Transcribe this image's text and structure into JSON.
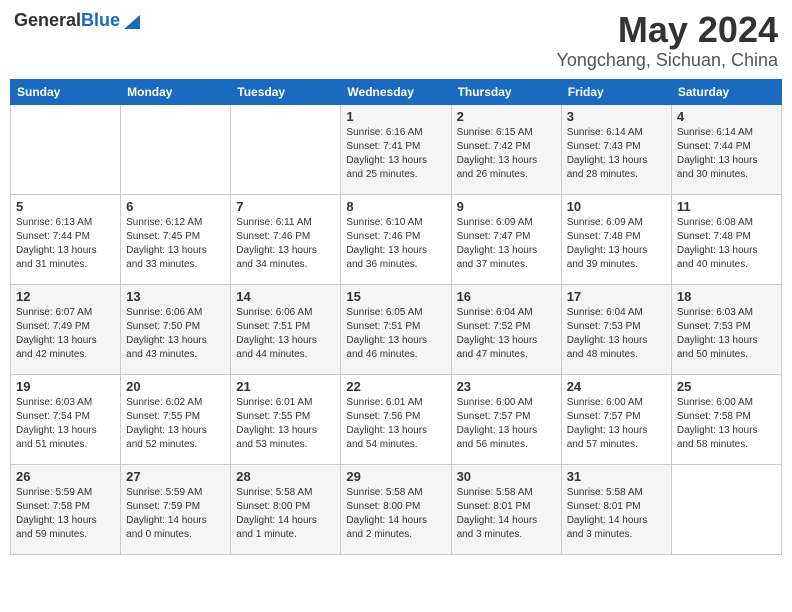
{
  "header": {
    "logo_general": "General",
    "logo_blue": "Blue",
    "month": "May 2024",
    "location": "Yongchang, Sichuan, China"
  },
  "weekdays": [
    "Sunday",
    "Monday",
    "Tuesday",
    "Wednesday",
    "Thursday",
    "Friday",
    "Saturday"
  ],
  "weeks": [
    [
      {
        "day": "",
        "info": ""
      },
      {
        "day": "",
        "info": ""
      },
      {
        "day": "",
        "info": ""
      },
      {
        "day": "1",
        "info": "Sunrise: 6:16 AM\nSunset: 7:41 PM\nDaylight: 13 hours\nand 25 minutes."
      },
      {
        "day": "2",
        "info": "Sunrise: 6:15 AM\nSunset: 7:42 PM\nDaylight: 13 hours\nand 26 minutes."
      },
      {
        "day": "3",
        "info": "Sunrise: 6:14 AM\nSunset: 7:43 PM\nDaylight: 13 hours\nand 28 minutes."
      },
      {
        "day": "4",
        "info": "Sunrise: 6:14 AM\nSunset: 7:44 PM\nDaylight: 13 hours\nand 30 minutes."
      }
    ],
    [
      {
        "day": "5",
        "info": "Sunrise: 6:13 AM\nSunset: 7:44 PM\nDaylight: 13 hours\nand 31 minutes."
      },
      {
        "day": "6",
        "info": "Sunrise: 6:12 AM\nSunset: 7:45 PM\nDaylight: 13 hours\nand 33 minutes."
      },
      {
        "day": "7",
        "info": "Sunrise: 6:11 AM\nSunset: 7:46 PM\nDaylight: 13 hours\nand 34 minutes."
      },
      {
        "day": "8",
        "info": "Sunrise: 6:10 AM\nSunset: 7:46 PM\nDaylight: 13 hours\nand 36 minutes."
      },
      {
        "day": "9",
        "info": "Sunrise: 6:09 AM\nSunset: 7:47 PM\nDaylight: 13 hours\nand 37 minutes."
      },
      {
        "day": "10",
        "info": "Sunrise: 6:09 AM\nSunset: 7:48 PM\nDaylight: 13 hours\nand 39 minutes."
      },
      {
        "day": "11",
        "info": "Sunrise: 6:08 AM\nSunset: 7:48 PM\nDaylight: 13 hours\nand 40 minutes."
      }
    ],
    [
      {
        "day": "12",
        "info": "Sunrise: 6:07 AM\nSunset: 7:49 PM\nDaylight: 13 hours\nand 42 minutes."
      },
      {
        "day": "13",
        "info": "Sunrise: 6:06 AM\nSunset: 7:50 PM\nDaylight: 13 hours\nand 43 minutes."
      },
      {
        "day": "14",
        "info": "Sunrise: 6:06 AM\nSunset: 7:51 PM\nDaylight: 13 hours\nand 44 minutes."
      },
      {
        "day": "15",
        "info": "Sunrise: 6:05 AM\nSunset: 7:51 PM\nDaylight: 13 hours\nand 46 minutes."
      },
      {
        "day": "16",
        "info": "Sunrise: 6:04 AM\nSunset: 7:52 PM\nDaylight: 13 hours\nand 47 minutes."
      },
      {
        "day": "17",
        "info": "Sunrise: 6:04 AM\nSunset: 7:53 PM\nDaylight: 13 hours\nand 48 minutes."
      },
      {
        "day": "18",
        "info": "Sunrise: 6:03 AM\nSunset: 7:53 PM\nDaylight: 13 hours\nand 50 minutes."
      }
    ],
    [
      {
        "day": "19",
        "info": "Sunrise: 6:03 AM\nSunset: 7:54 PM\nDaylight: 13 hours\nand 51 minutes."
      },
      {
        "day": "20",
        "info": "Sunrise: 6:02 AM\nSunset: 7:55 PM\nDaylight: 13 hours\nand 52 minutes."
      },
      {
        "day": "21",
        "info": "Sunrise: 6:01 AM\nSunset: 7:55 PM\nDaylight: 13 hours\nand 53 minutes."
      },
      {
        "day": "22",
        "info": "Sunrise: 6:01 AM\nSunset: 7:56 PM\nDaylight: 13 hours\nand 54 minutes."
      },
      {
        "day": "23",
        "info": "Sunrise: 6:00 AM\nSunset: 7:57 PM\nDaylight: 13 hours\nand 56 minutes."
      },
      {
        "day": "24",
        "info": "Sunrise: 6:00 AM\nSunset: 7:57 PM\nDaylight: 13 hours\nand 57 minutes."
      },
      {
        "day": "25",
        "info": "Sunrise: 6:00 AM\nSunset: 7:58 PM\nDaylight: 13 hours\nand 58 minutes."
      }
    ],
    [
      {
        "day": "26",
        "info": "Sunrise: 5:59 AM\nSunset: 7:58 PM\nDaylight: 13 hours\nand 59 minutes."
      },
      {
        "day": "27",
        "info": "Sunrise: 5:59 AM\nSunset: 7:59 PM\nDaylight: 14 hours\nand 0 minutes."
      },
      {
        "day": "28",
        "info": "Sunrise: 5:58 AM\nSunset: 8:00 PM\nDaylight: 14 hours\nand 1 minute."
      },
      {
        "day": "29",
        "info": "Sunrise: 5:58 AM\nSunset: 8:00 PM\nDaylight: 14 hours\nand 2 minutes."
      },
      {
        "day": "30",
        "info": "Sunrise: 5:58 AM\nSunset: 8:01 PM\nDaylight: 14 hours\nand 3 minutes."
      },
      {
        "day": "31",
        "info": "Sunrise: 5:58 AM\nSunset: 8:01 PM\nDaylight: 14 hours\nand 3 minutes."
      },
      {
        "day": "",
        "info": ""
      }
    ]
  ]
}
